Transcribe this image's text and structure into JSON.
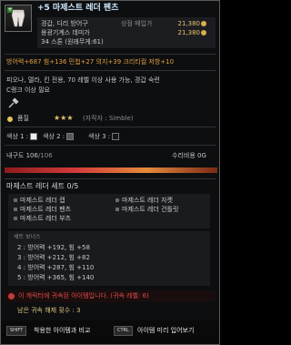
{
  "item": {
    "plus_badge": "+",
    "title": "+5 마제스트 레더 펜츠"
  },
  "info": {
    "type_label": "경갑, 디리 방어구",
    "shop_label": "상점 매입가",
    "shop_value": "21,380",
    "repair_label": "용광기계스 데미가",
    "repair_value": "21,380",
    "stone": "34 스톤 (원래무게:61)"
  },
  "stats": {
    "line1": "방어력+687  힘+136  민첩+27  의지+39  크리티컬 저항+10"
  },
  "description": {
    "line1": "피오나, 델라, 킨 전용, 70 레벨 이상 사용 가능, 경갑 숙련",
    "line2": "C랭크 이상 필요"
  },
  "quality": {
    "label": "품질",
    "stars": "★★★",
    "maker": "(자작자 : Simble)"
  },
  "colors": {
    "c1_label": "색상 1 :",
    "c1_hex": "#f0f0f0",
    "c2_label": "색상 2 :",
    "c2_hex": "#5a5a5a",
    "c3_label": "색상 3 :",
    "c3_hex": "#151515"
  },
  "durability": {
    "label": "내구도",
    "current": "106",
    "max": "/106",
    "repair_label": "수리비용",
    "repair_value": "0G",
    "fill_percent": 100
  },
  "set": {
    "title": "마제스트 레더 세트",
    "count": "0/5",
    "items": [
      "마제스트 레더 캡",
      "마제스트 레더 자켓",
      "마제스트 레더 펜츠",
      "마제스트 레더 건틀릿",
      "마제스트 레더 부츠"
    ],
    "bonus_title": "세트 보너스",
    "bonuses": [
      "2 : 방어력 +192, 힘 +58",
      "3 : 방어력 +212, 힘 +82",
      "4 : 방어력 +287, 힘 +110",
      "5 : 방어력 +365, 힘 +140"
    ]
  },
  "warning": {
    "text": "이 캐릭터에 귀속된 아이템입니다. (귀속 레벨: 6)"
  },
  "sell": {
    "text": "남은 귀속 해제 횟수 : 3"
  },
  "keys": {
    "shift_key": "SHIFT",
    "shift_label": "착용한 아이템과 비교",
    "ctrl_key": "CTRL",
    "ctrl_label": "아이템 미리 입어보기"
  }
}
